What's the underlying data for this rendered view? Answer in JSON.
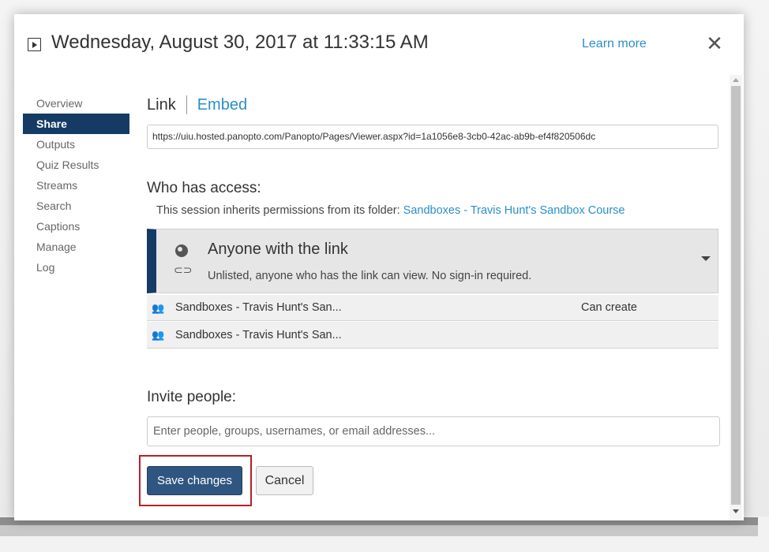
{
  "header": {
    "title": "Wednesday, August 30, 2017 at 11:33:15 AM",
    "learn_more": "Learn more",
    "close_glyph": "✕"
  },
  "sidebar": {
    "items": [
      {
        "label": "Overview",
        "active": false
      },
      {
        "label": "Share",
        "active": true
      },
      {
        "label": "Outputs",
        "active": false
      },
      {
        "label": "Quiz Results",
        "active": false
      },
      {
        "label": "Streams",
        "active": false
      },
      {
        "label": "Search",
        "active": false
      },
      {
        "label": "Captions",
        "active": false
      },
      {
        "label": "Manage",
        "active": false
      },
      {
        "label": "Log",
        "active": false
      }
    ]
  },
  "share": {
    "tab_link": "Link",
    "tab_embed": "Embed",
    "url": "https://uiu.hosted.panopto.com/Panopto/Pages/Viewer.aspx?id=1a1056e8-3cb0-42ac-ab9b-ef4f820506dc",
    "who_has_access": "Who has access:",
    "inherit_prefix": "This session inherits permissions from its folder: ",
    "inherit_folder": "Sandboxes - Travis Hunt's Sandbox Course",
    "access": {
      "title": "Anyone with the link",
      "description": "Unlisted, anyone who has the link can view. No sign-in required."
    },
    "permissions": [
      {
        "name": "Sandboxes - Travis Hunt's San...",
        "role": "Can create"
      },
      {
        "name": "Sandboxes - Travis Hunt's San...",
        "role": ""
      }
    ],
    "invite_heading": "Invite people:",
    "invite_placeholder": "Enter people, groups, usernames, or email addresses...",
    "save_label": "Save changes",
    "cancel_label": "Cancel"
  },
  "colors": {
    "accent": "#2a8fc6",
    "nav_active": "#153b64",
    "save_button": "#2f5680",
    "highlight": "#b52025"
  }
}
